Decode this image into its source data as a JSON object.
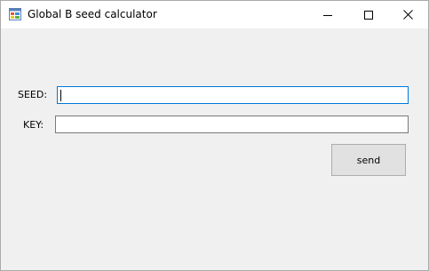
{
  "window": {
    "title": "Global B seed calculator",
    "controls": {
      "minimize_icon": "minimize-icon",
      "maximize_icon": "maximize-icon",
      "close_icon": "close-icon"
    }
  },
  "form": {
    "seed_label": "SEED:",
    "seed_value": "",
    "key_label": "KEY:",
    "key_value": "",
    "send_label": "send"
  },
  "colors": {
    "background": "#f0f0f0",
    "titlebar": "#ffffff",
    "focus_border": "#0078d7",
    "input_border": "#7a7a7a",
    "button_face": "#e1e1e1",
    "button_border": "#adadad"
  }
}
